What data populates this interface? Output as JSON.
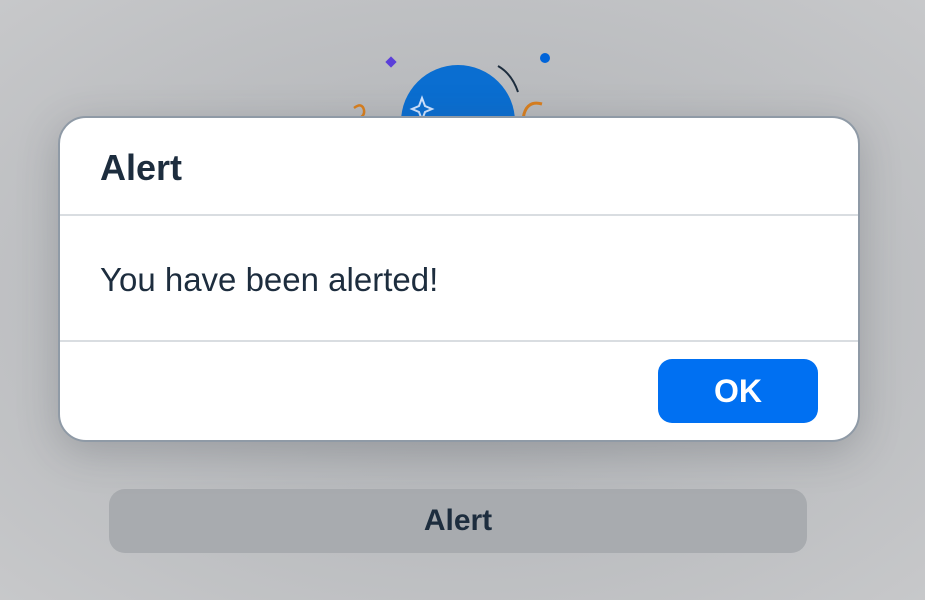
{
  "background": {
    "trigger_button_label": "Alert"
  },
  "dialog": {
    "title": "Alert",
    "message": "You have been alerted!",
    "ok_label": "OK"
  },
  "illustration": {
    "name": "alert-illustration",
    "accent": "#0a6ed1",
    "decor_colors": [
      "#5b3fd9",
      "#0064d9",
      "#d97f1e",
      "#1d2d3e"
    ]
  },
  "colors": {
    "primary_button": "#0070f2",
    "text": "#1d2d3e",
    "overlay": "#b8babd"
  }
}
